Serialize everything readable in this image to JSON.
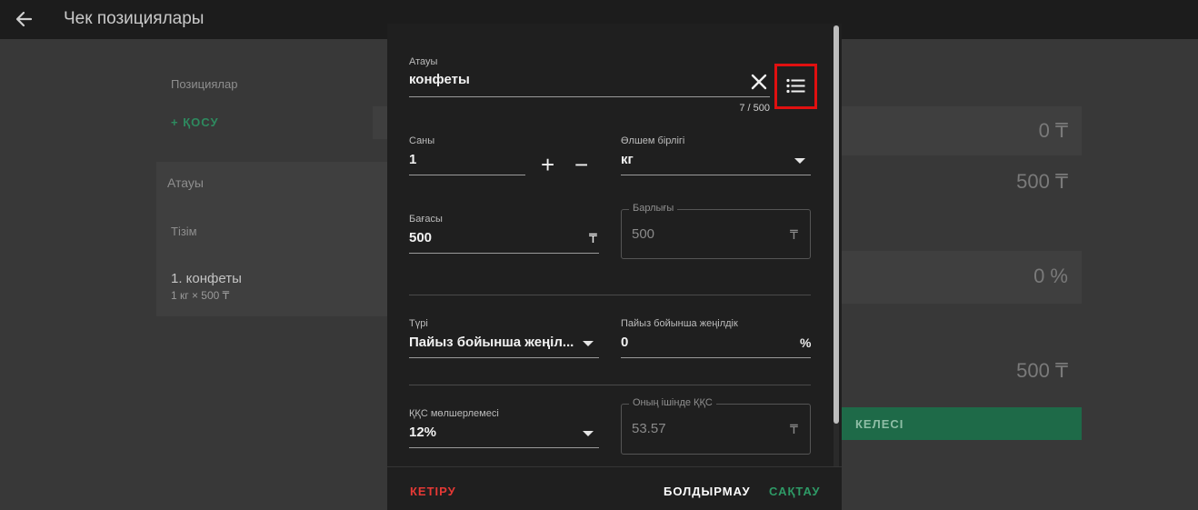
{
  "header": {
    "title": "Чек позициялары",
    "back_icon": "arrow-left-icon"
  },
  "background": {
    "positions_label": "Позициялар",
    "add_label": "+ ҚОСУ",
    "name_label": "Атауы",
    "list_label": "Тізім",
    "item_name": "1. конфеты",
    "item_detail": "1 кг × 500 ₸",
    "amount_1": "0 ₸",
    "amount_2": "500 ₸",
    "percent": "0 %",
    "total": "500 ₸",
    "next_label": "КЕЛЕСІ"
  },
  "dialog": {
    "name": {
      "label": "Атауы",
      "value": "конфеты",
      "counter": "7 / 500",
      "clear_icon": "close-icon",
      "list_icon": "list-icon"
    },
    "quantity": {
      "label": "Саны",
      "value": "1",
      "plus": "+",
      "minus": "−"
    },
    "unit": {
      "label": "Өлшем бірлігі",
      "value": "кг"
    },
    "price": {
      "label": "Бағасы",
      "value": "500",
      "suffix": "₸"
    },
    "total": {
      "label": "Барлығы",
      "value": "500",
      "suffix": "₸"
    },
    "type": {
      "label": "Түрі",
      "value": "Пайыз бойынша жеңіл..."
    },
    "discount": {
      "label": "Пайыз бойынша жеңілдік",
      "value": "0",
      "suffix": "%"
    },
    "vat_rate": {
      "label": "ҚҚС мөлшерлемесі",
      "value": "12%"
    },
    "vat_included": {
      "label": "Оның ішінде ҚҚС",
      "value": "53.57",
      "suffix": "₸"
    }
  },
  "footer": {
    "remove_label": "КЕТІРУ",
    "cancel_label": "БОЛДЫРМАУ",
    "save_label": "САҚТАУ"
  },
  "colors": {
    "accent_green": "#2e9a66",
    "danger_red": "#e53935",
    "highlight_box": "#e01010"
  }
}
